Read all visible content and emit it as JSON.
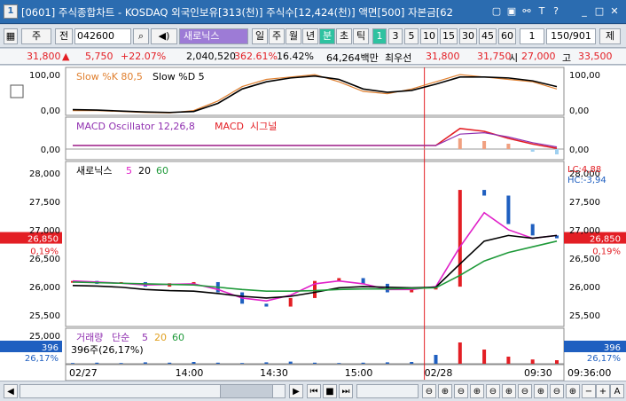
{
  "title": {
    "num": "1",
    "text": "[0601] 주식종합차트 - KOSDAQ 외국인보유[313(천)] 주식수[12,424(천)] 액면[500] 자본금[62",
    "icons": [
      "restore-icon",
      "panel-icon",
      "link-icon",
      "text-icon",
      "help-icon",
      "minimize-icon",
      "maximize-icon",
      "close-icon"
    ]
  },
  "toolbar": {
    "market": "주",
    "all": "전",
    "code": "042600",
    "name": "새로닉스",
    "periods": [
      "일",
      "주",
      "월",
      "년",
      "분",
      "초",
      "틱"
    ],
    "active_period": "분",
    "intervals": [
      "1",
      "3",
      "5",
      "10",
      "15",
      "30",
      "45",
      "60"
    ],
    "active_interval": "1",
    "count": "1",
    "paging": "150/901",
    "extra": "제"
  },
  "quote": {
    "price": "31,800",
    "change": "5,750",
    "change_pct": "+22.07%",
    "volume": "2,040,520",
    "vol_ratio": "362.61%",
    "turnover": "16.42%",
    "amount": "64,264백만",
    "best_label": "최우선",
    "ask": "31,800",
    "bid": "31,750",
    "open_label": "시",
    "open": "27,000",
    "high_label": "고",
    "high": "33,500"
  },
  "panels": {
    "stoch": {
      "title1": "Slow %K 80,5",
      "title2": "Slow %D 5",
      "ticks": [
        "100,00",
        "0,00"
      ]
    },
    "macd": {
      "title1": "MACD Oscillator 12,26,8",
      "title2": "MACD",
      "title3": "시그널",
      "ticks": [
        "0,00"
      ]
    },
    "price": {
      "title": "새로닉스",
      "ma": [
        "5",
        "20",
        "60"
      ],
      "ticks": [
        "28,000",
        "27,500",
        "27,000",
        "26,500",
        "26,000",
        "25,500"
      ],
      "tag_price": "26,850",
      "tag_pct": "0,19%",
      "lc": "LC:4,88",
      "hc": "HC:-3,94"
    },
    "volume": {
      "title": "거래량",
      "sub": "단순",
      "ma": [
        "5",
        "20",
        "60"
      ],
      "ticks": [
        "25,000"
      ],
      "tag_vol": "396",
      "tag_pct": "26,17%",
      "desc": "396주(26,17%)"
    }
  },
  "xaxis": {
    "labels": [
      "02/27",
      "14:00",
      "14:30",
      "15:00",
      "02/28",
      "09:30"
    ],
    "time": "09:36:00"
  },
  "colors": {
    "up": "#e31e24",
    "down": "#1f5fc0",
    "ma5": "#e020c8",
    "ma20": "#000000",
    "ma60": "#1f9a3a",
    "title": "#2b6cb0"
  },
  "chart_data": {
    "type": "line",
    "series": [
      {
        "name": "Slow %K 80,5",
        "values": [
          10,
          10,
          8,
          6,
          5,
          10,
          30,
          60,
          75,
          80,
          85,
          70,
          50,
          45,
          55,
          70,
          85,
          80,
          75,
          70,
          55
        ]
      },
      {
        "name": "Slow %D 5",
        "values": [
          12,
          11,
          9,
          7,
          6,
          8,
          25,
          55,
          70,
          78,
          82,
          75,
          55,
          48,
          52,
          65,
          80,
          80,
          78,
          72,
          60
        ]
      },
      {
        "name": "MACD Oscillator 12,26,8",
        "values": [
          0,
          0,
          0,
          0,
          0,
          0,
          0,
          0,
          0,
          0,
          0,
          0,
          0,
          0,
          0,
          0,
          4,
          3,
          2,
          -1,
          -2
        ]
      },
      {
        "name": "MACD",
        "values": [
          0,
          0,
          0,
          0,
          0,
          0,
          0,
          0,
          0,
          0,
          0,
          0,
          0,
          0,
          0,
          0,
          12,
          10,
          5,
          1,
          -2
        ]
      },
      {
        "name": "시그널",
        "values": [
          0,
          0,
          0,
          0,
          0,
          0,
          0,
          0,
          0,
          0,
          0,
          0,
          0,
          0,
          0,
          0,
          8,
          9,
          6,
          2,
          -1
        ]
      }
    ],
    "price": {
      "ylim": [
        25300,
        28200
      ],
      "closes": [
        26100,
        26050,
        26080,
        26000,
        26060,
        26080,
        25900,
        25700,
        25650,
        25800,
        26100,
        26150,
        26050,
        25900,
        25950,
        26000,
        27700,
        27600,
        27100,
        26900,
        26850
      ],
      "ma5": [
        26100,
        26080,
        26060,
        26030,
        26040,
        26050,
        25950,
        25800,
        25750,
        25850,
        26050,
        26100,
        26050,
        25950,
        25950,
        26000,
        26700,
        27300,
        27000,
        26850,
        26900
      ],
      "ma20": [
        26020,
        26010,
        25990,
        25950,
        25930,
        25920,
        25880,
        25830,
        25800,
        25830,
        25900,
        25980,
        26000,
        25990,
        25980,
        25990,
        26400,
        26800,
        26900,
        26850,
        26900
      ],
      "ma60": [
        26080,
        26070,
        26060,
        26050,
        26040,
        26030,
        25990,
        25950,
        25920,
        25920,
        25930,
        25950,
        25960,
        25960,
        25970,
        25980,
        26200,
        26450,
        26600,
        26700,
        26800
      ]
    },
    "volume_bars": [
      2,
      3,
      2,
      4,
      3,
      5,
      3,
      2,
      4,
      6,
      3,
      2,
      3,
      4,
      5,
      25,
      60,
      40,
      20,
      12,
      10
    ]
  }
}
